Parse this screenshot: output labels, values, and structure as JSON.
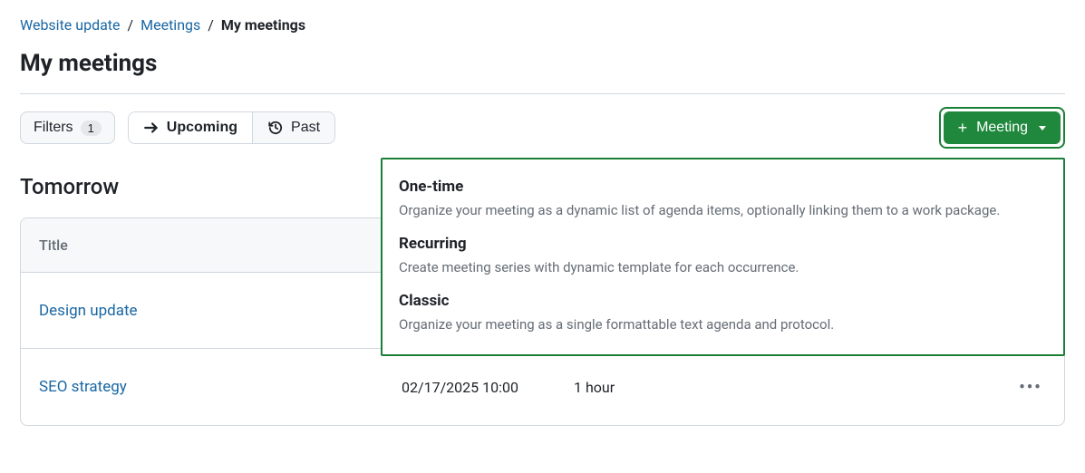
{
  "breadcrumb": {
    "project": "Website update",
    "module": "Meetings",
    "current": "My meetings"
  },
  "page_title": "My meetings",
  "toolbar": {
    "filters_label": "Filters",
    "filters_count": "1",
    "upcoming_label": "Upcoming",
    "past_label": "Past",
    "meeting_button_label": "Meeting"
  },
  "dropdown": {
    "options": [
      {
        "title": "One-time",
        "desc": "Organize your meeting as a dynamic list of agenda items, optionally linking them to a work package."
      },
      {
        "title": "Recurring",
        "desc": "Create meeting series with dynamic template for each occurrence."
      },
      {
        "title": "Classic",
        "desc": "Organize your meeting as a single formattable text agenda and protocol."
      }
    ]
  },
  "section_title": "Tomorrow",
  "table": {
    "headers": {
      "title": "Title"
    },
    "rows": [
      {
        "title": "Design update",
        "date": "",
        "duration": ""
      },
      {
        "title": "SEO strategy",
        "date": "02/17/2025 10:00",
        "duration": "1 hour"
      }
    ]
  }
}
